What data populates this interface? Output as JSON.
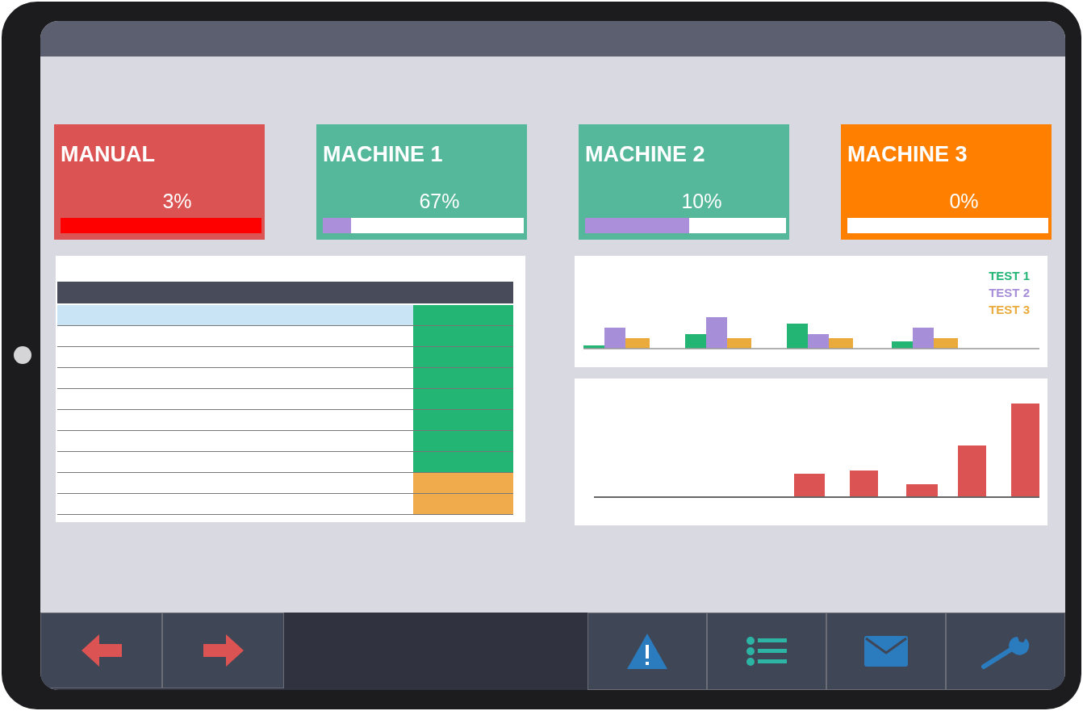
{
  "status_cards": [
    {
      "title": "MANUAL",
      "percent": "3%",
      "color": "#db5352",
      "level": 1
    },
    {
      "title": "MACHINE 1",
      "percent": "67%",
      "color": "#55b89a",
      "level": 0.14
    },
    {
      "title": "MACHINE 2",
      "percent": "10%",
      "color": "#55b89a",
      "level": 0.52
    },
    {
      "title": "MACHINE 3",
      "percent": "0%",
      "color": "#ff8000"
    }
  ],
  "table": {
    "rows": [
      {
        "selected": true,
        "color": "#22b574"
      },
      {
        "selected": false,
        "color": "#22b574"
      },
      {
        "selected": false,
        "color": "#22b574"
      },
      {
        "selected": false,
        "color": "#22b574"
      },
      {
        "selected": false,
        "color": "#22b574"
      },
      {
        "selected": false,
        "color": "#22b574"
      },
      {
        "selected": false,
        "color": "#22b574"
      },
      {
        "selected": false,
        "color": "#22b574"
      },
      {
        "selected": false,
        "color": "#efab4c"
      },
      {
        "selected": false,
        "color": "#efab4c"
      }
    ]
  },
  "legend": [
    {
      "label": "TEST 1",
      "color": "#22b574"
    },
    {
      "label": "TEST 2",
      "color": "#a68ed8"
    },
    {
      "label": "TEST 3",
      "color": "#eaab3c"
    }
  ]
}
